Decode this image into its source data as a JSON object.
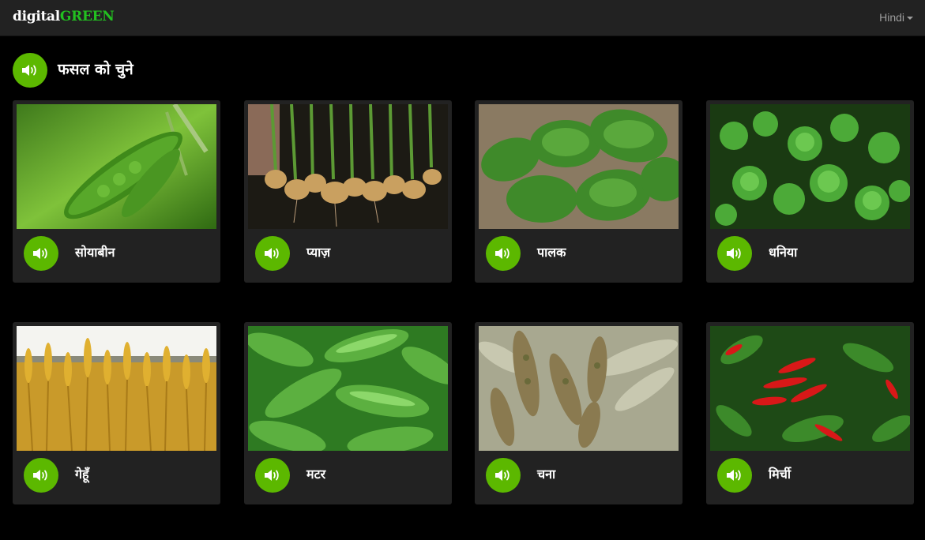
{
  "navbar": {
    "brand_part1": "digital",
    "brand_part2": "GREEN",
    "language": "Hindi"
  },
  "page": {
    "heading": "फसल को चुने"
  },
  "colors": {
    "accent_green": "#5cb800",
    "brand_green": "#22c020",
    "card_bg": "#222222",
    "page_bg": "#000000"
  },
  "crops": [
    {
      "label": "सोयाबीन",
      "image": "soybean-image"
    },
    {
      "label": "प्याज़",
      "image": "onion-image"
    },
    {
      "label": "पालक",
      "image": "spinach-image"
    },
    {
      "label": "धनिया",
      "image": "coriander-image"
    },
    {
      "label": "गेहूँ",
      "image": "wheat-image"
    },
    {
      "label": "मटर",
      "image": "peas-image"
    },
    {
      "label": "चना",
      "image": "chickpea-image"
    },
    {
      "label": "मिर्ची",
      "image": "chili-image"
    }
  ]
}
